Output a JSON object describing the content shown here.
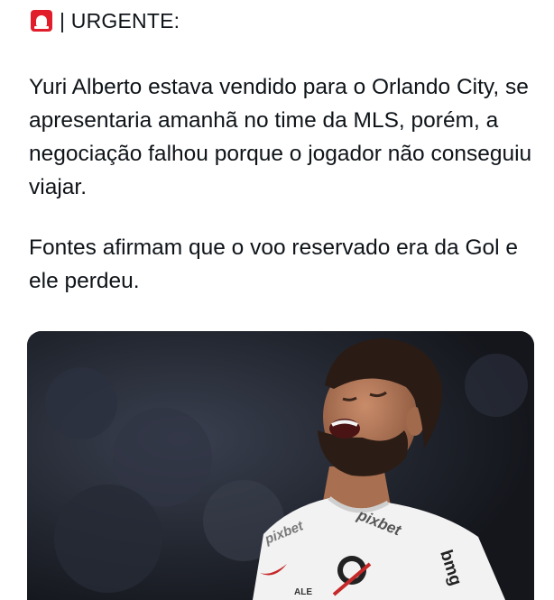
{
  "post": {
    "header_icon": "siren-icon",
    "header": "| URGENTE:",
    "paragraphs": [
      "Yuri Alberto estava vendido para o Orlando City, se apresentaria amanhã no time da MLS, porém, a negociação falhou porque o jogador não conseguiu viajar.",
      "Fontes afirmam que o voo reservado era da Gol e ele perdeu."
    ]
  },
  "media": {
    "jersey_texts": [
      "pixbet",
      "pixbet",
      "ALE",
      "bmg"
    ]
  },
  "colors": {
    "text": "#0f1419",
    "siren": "#e11d2c",
    "photo_background": "#1b1f28",
    "jersey": "#f2f2f2"
  }
}
